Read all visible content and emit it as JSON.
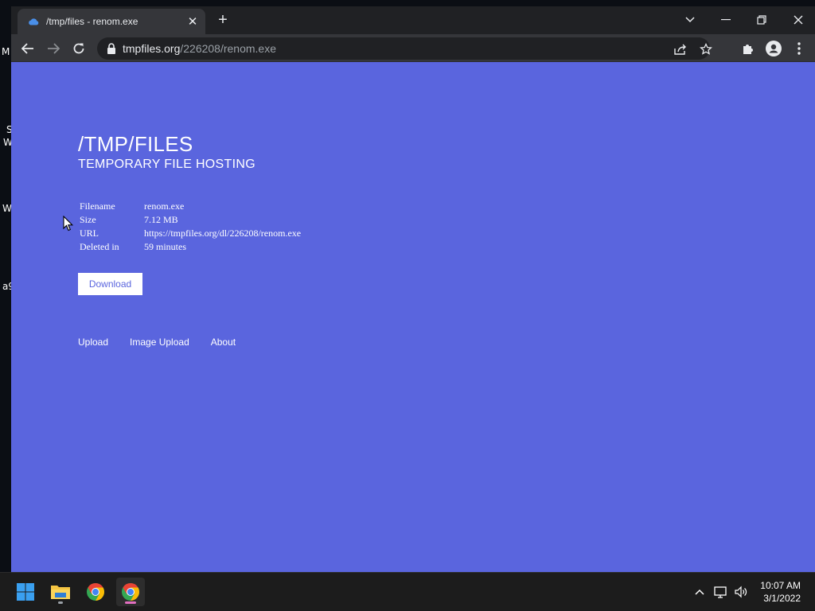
{
  "desktop_fragments": [
    "M",
    "S",
    "W",
    "W",
    "a9"
  ],
  "browser": {
    "tab_title": "/tmp/files - renom.exe",
    "url_host": "tmpfiles.org",
    "url_path": "/226208/renom.exe"
  },
  "page": {
    "title": "/TMP/FILES",
    "subtitle": "TEMPORARY FILE HOSTING",
    "info": [
      {
        "label": "Filename",
        "value": "renom.exe"
      },
      {
        "label": "Size",
        "value": "7.12 MB"
      },
      {
        "label": "URL",
        "value": "https://tmpfiles.org/dl/226208/renom.exe"
      },
      {
        "label": "Deleted in",
        "value": "59 minutes"
      }
    ],
    "download_label": "Download",
    "nav": [
      "Upload",
      "Image Upload",
      "About"
    ]
  },
  "taskbar": {
    "apps": [
      "start-icon",
      "file-explorer-icon",
      "chrome-icon",
      "chrome-icon"
    ],
    "clock_time": "10:07 AM",
    "clock_date": "3/1/2022"
  },
  "colors": {
    "page_bg": "#5a65de",
    "chrome_dark": "#202124",
    "chrome_toolbar": "#35363a"
  }
}
